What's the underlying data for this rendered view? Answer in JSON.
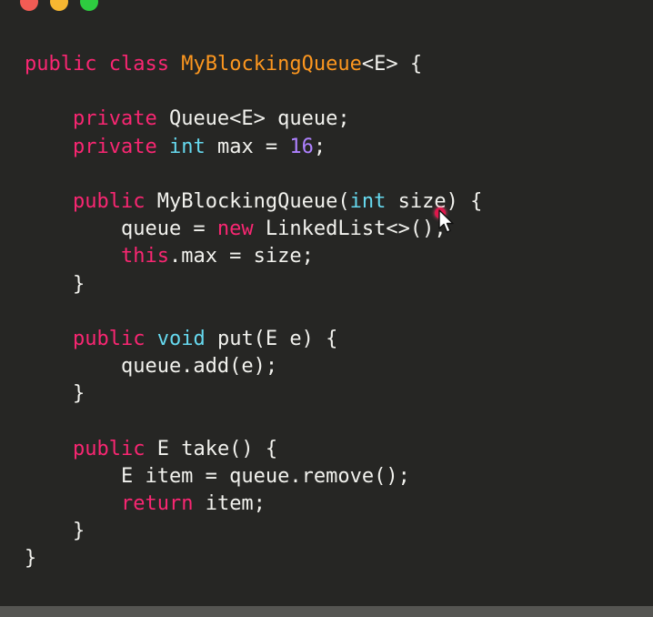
{
  "window": {
    "traffic_lights": {
      "close_color": "#f25c54",
      "minimize_color": "#f7b731",
      "maximize_color": "#2ecc40"
    }
  },
  "colors": {
    "background": "#262624",
    "keyword": "#f92672",
    "type": "#66d9ef",
    "class_name": "#fd971f",
    "number": "#ae81ff",
    "text": "#f2f2ee"
  },
  "code": {
    "lines": [
      [
        {
          "t": "public",
          "k": "keyword"
        },
        {
          "t": " "
        },
        {
          "t": "class",
          "k": "keyword"
        },
        {
          "t": " "
        },
        {
          "t": "MyBlockingQueue",
          "k": "class"
        },
        {
          "t": "<E> {"
        }
      ],
      [],
      [
        {
          "t": "    "
        },
        {
          "t": "private",
          "k": "keyword"
        },
        {
          "t": " Queue<E> queue;"
        }
      ],
      [
        {
          "t": "    "
        },
        {
          "t": "private",
          "k": "keyword"
        },
        {
          "t": " "
        },
        {
          "t": "int",
          "k": "type"
        },
        {
          "t": " max = "
        },
        {
          "t": "16",
          "k": "number"
        },
        {
          "t": ";"
        }
      ],
      [],
      [
        {
          "t": "    "
        },
        {
          "t": "public",
          "k": "keyword"
        },
        {
          "t": " MyBlockingQueue("
        },
        {
          "t": "int",
          "k": "type"
        },
        {
          "t": " size) {"
        }
      ],
      [
        {
          "t": "        queue = "
        },
        {
          "t": "new",
          "k": "keyword"
        },
        {
          "t": " LinkedList<>();"
        }
      ],
      [
        {
          "t": "        "
        },
        {
          "t": "this",
          "k": "keyword"
        },
        {
          "t": ".max = size;"
        }
      ],
      [
        {
          "t": "    }"
        }
      ],
      [],
      [
        {
          "t": "    "
        },
        {
          "t": "public",
          "k": "keyword"
        },
        {
          "t": " "
        },
        {
          "t": "void",
          "k": "type"
        },
        {
          "t": " put(E e) {"
        }
      ],
      [
        {
          "t": "        queue.add(e);"
        }
      ],
      [
        {
          "t": "    }"
        }
      ],
      [],
      [
        {
          "t": "    "
        },
        {
          "t": "public",
          "k": "keyword"
        },
        {
          "t": " E take() {"
        }
      ],
      [
        {
          "t": "        E item = queue.remove();"
        }
      ],
      [
        {
          "t": "        "
        },
        {
          "t": "return",
          "k": "keyword"
        },
        {
          "t": " item;"
        }
      ],
      [
        {
          "t": "    }"
        }
      ],
      [
        {
          "t": "}"
        }
      ]
    ]
  },
  "icons": {
    "pointer": "mouse-pointer-icon",
    "laser": "laser-pointer-dot"
  }
}
